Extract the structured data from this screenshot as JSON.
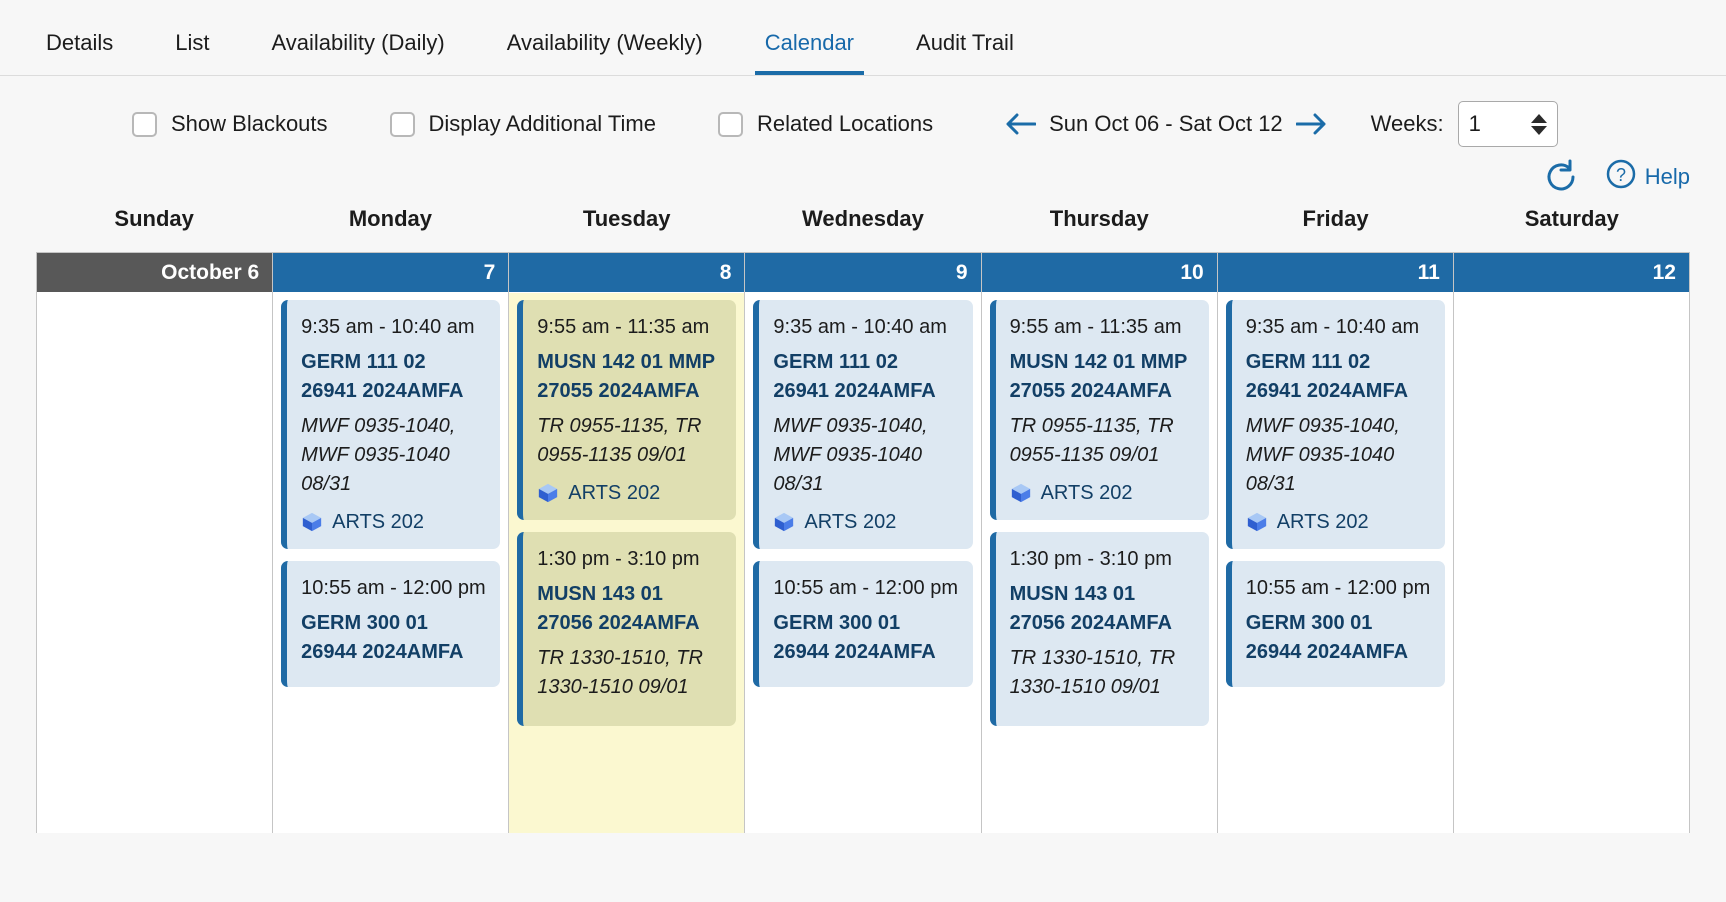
{
  "tabs": [
    {
      "label": "Details",
      "active": false
    },
    {
      "label": "List",
      "active": false
    },
    {
      "label": "Availability (Daily)",
      "active": false
    },
    {
      "label": "Availability (Weekly)",
      "active": false
    },
    {
      "label": "Calendar",
      "active": true
    },
    {
      "label": "Audit Trail",
      "active": false
    }
  ],
  "toolbar": {
    "checkboxes": [
      {
        "label": "Show Blackouts",
        "checked": false
      },
      {
        "label": "Display Additional Time",
        "checked": false
      },
      {
        "label": "Related Locations",
        "checked": false
      }
    ],
    "prev_icon": "arrow-left-icon",
    "next_icon": "arrow-right-icon",
    "date_range": "Sun Oct 06 - Sat Oct 12",
    "weeks_label": "Weeks:",
    "weeks_value": "1",
    "refresh_icon": "refresh-icon",
    "help_icon": "question-circle-icon",
    "help_label": "Help",
    "accent_color": "#1b6ca8",
    "header_blue": "#1f6aa5",
    "sunday_gray": "#585858",
    "event_bg": "#dde8f2",
    "highlight_bg": "#fbf8d0"
  },
  "calendar": {
    "day_names": [
      "Sunday",
      "Monday",
      "Tuesday",
      "Wednesday",
      "Thursday",
      "Friday",
      "Saturday"
    ],
    "columns": [
      {
        "day_label": "October 6",
        "highlight": false,
        "events": []
      },
      {
        "day_label": "7",
        "highlight": false,
        "events": [
          {
            "time": "9:35 am - 10:40 am",
            "title": "GERM 111 02 26941 2024AMFA",
            "pattern": "MWF 0935-1040, MWF 0935-1040 08/31",
            "location": "ARTS 202",
            "location_icon": "cube-icon"
          },
          {
            "time": "10:55 am - 12:00 pm",
            "title": "GERM 300 01 26944 2024AMFA",
            "pattern": "",
            "location": "",
            "location_icon": "cube-icon"
          }
        ]
      },
      {
        "day_label": "8",
        "highlight": true,
        "events": [
          {
            "time": "9:55 am - 11:35 am",
            "title": "MUSN 142 01 MMP 27055 2024AMFA",
            "pattern": "TR 0955-1135, TR 0955-1135 09/01",
            "location": "ARTS 202",
            "location_icon": "cube-icon"
          },
          {
            "time": "1:30 pm - 3:10 pm",
            "title": "MUSN 143 01 27056 2024AMFA",
            "pattern": "TR 1330-1510, TR 1330-1510 09/01",
            "location": "",
            "location_icon": "cube-icon"
          }
        ]
      },
      {
        "day_label": "9",
        "highlight": false,
        "events": [
          {
            "time": "9:35 am - 10:40 am",
            "title": "GERM 111 02 26941 2024AMFA",
            "pattern": "MWF 0935-1040, MWF 0935-1040 08/31",
            "location": "ARTS 202",
            "location_icon": "cube-icon"
          },
          {
            "time": "10:55 am - 12:00 pm",
            "title": "GERM 300 01 26944 2024AMFA",
            "pattern": "",
            "location": "",
            "location_icon": "cube-icon"
          }
        ]
      },
      {
        "day_label": "10",
        "highlight": false,
        "events": [
          {
            "time": "9:55 am - 11:35 am",
            "title": "MUSN 142 01 MMP 27055 2024AMFA",
            "pattern": "TR 0955-1135, TR 0955-1135 09/01",
            "location": "ARTS 202",
            "location_icon": "cube-icon"
          },
          {
            "time": "1:30 pm - 3:10 pm",
            "title": "MUSN 143 01 27056 2024AMFA",
            "pattern": "TR 1330-1510, TR 1330-1510 09/01",
            "location": "",
            "location_icon": "cube-icon"
          }
        ]
      },
      {
        "day_label": "11",
        "highlight": false,
        "events": [
          {
            "time": "9:35 am - 10:40 am",
            "title": "GERM 111 02 26941 2024AMFA",
            "pattern": "MWF 0935-1040, MWF 0935-1040 08/31",
            "location": "ARTS 202",
            "location_icon": "cube-icon"
          },
          {
            "time": "10:55 am - 12:00 pm",
            "title": "GERM 300 01 26944 2024AMFA",
            "pattern": "",
            "location": "",
            "location_icon": "cube-icon"
          }
        ]
      },
      {
        "day_label": "12",
        "highlight": false,
        "events": []
      }
    ]
  }
}
